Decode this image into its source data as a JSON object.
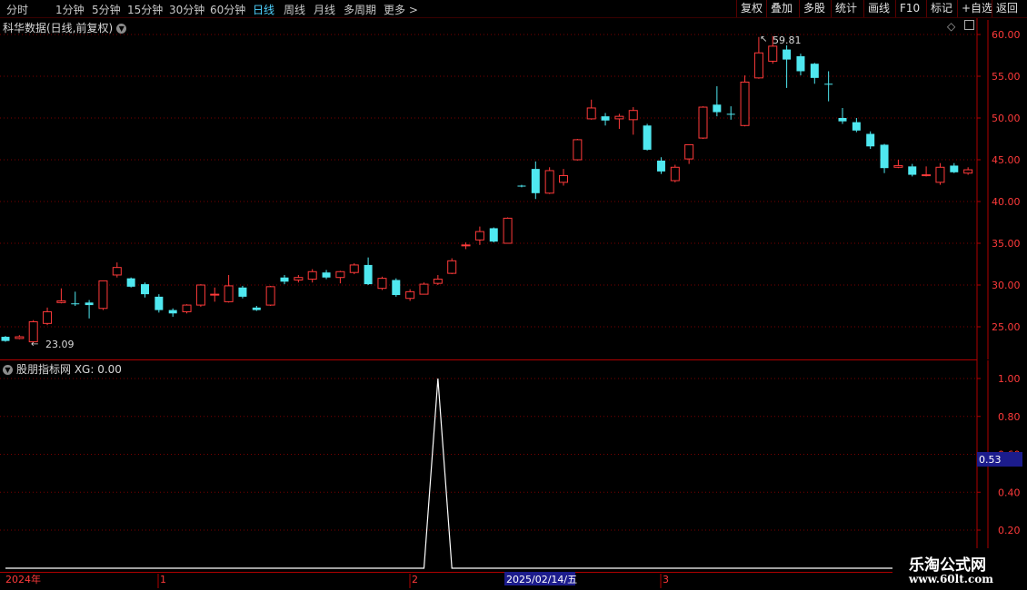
{
  "toolbar": {
    "periods": [
      "分时",
      "1分钟",
      "5分钟",
      "15分钟",
      "30分钟",
      "60分钟",
      "日线",
      "周线",
      "月线",
      "多周期",
      "更多"
    ],
    "active_period": "日线",
    "right_buttons": [
      "复权",
      "叠加",
      "多股",
      "统计",
      "画线",
      "F10",
      "标记",
      "+自选",
      "返回"
    ]
  },
  "main_chart": {
    "title": "科华数据(日线,前复权)",
    "high_label": "59.81",
    "low_label": "23.09"
  },
  "indicator": {
    "title": "股朋指标网 XG: 0.00",
    "cursor_value": "0.53"
  },
  "timeline": {
    "labels": [
      "2024年",
      "1",
      "2",
      "2025/02/14/五",
      "3"
    ]
  },
  "watermark": {
    "title": "乐淘公式网",
    "url": "www.60lt.com"
  },
  "colors": {
    "up": "#ff3a3a",
    "down": "#4fe8f0",
    "grid": "#7a0000",
    "axis": "#b00000",
    "accent": "#4fd2ff"
  },
  "chart_data": [
    {
      "type": "candlestick",
      "title": "科华数据(日线,前复权)",
      "ylim": [
        21,
        61
      ],
      "yticks": [
        25,
        30,
        35,
        40,
        45,
        50,
        55,
        60
      ],
      "ytick_labels": [
        "25.00",
        "30.00",
        "35.00",
        "40.00",
        "45.00",
        "50.00",
        "55.00",
        "60.00"
      ],
      "candles": [
        [
          23.8,
          23.3,
          23.9,
          23.2
        ],
        [
          23.6,
          23.8,
          24.0,
          23.5
        ],
        [
          23.2,
          25.6,
          25.8,
          23.09
        ],
        [
          25.4,
          26.8,
          27.3,
          25.2
        ],
        [
          27.9,
          28.1,
          29.6,
          27.8
        ],
        [
          27.8,
          27.7,
          29.2,
          27.5
        ],
        [
          27.9,
          27.6,
          28.2,
          26.0
        ],
        [
          27.2,
          30.5,
          30.5,
          27.0
        ],
        [
          31.2,
          32.1,
          32.7,
          30.9
        ],
        [
          30.8,
          29.8,
          30.9,
          29.7
        ],
        [
          30.1,
          28.9,
          30.3,
          28.5
        ],
        [
          28.6,
          27.0,
          28.9,
          26.7
        ],
        [
          27.0,
          26.6,
          27.2,
          26.2
        ],
        [
          26.8,
          27.6,
          27.7,
          26.6
        ],
        [
          27.6,
          30.0,
          30.1,
          27.4
        ],
        [
          28.8,
          28.9,
          29.7,
          28.0
        ],
        [
          28.0,
          29.9,
          31.2,
          27.9
        ],
        [
          29.7,
          28.6,
          29.9,
          28.4
        ],
        [
          27.3,
          27.0,
          27.5,
          26.9
        ],
        [
          27.6,
          29.8,
          29.9,
          27.5
        ],
        [
          30.9,
          30.4,
          31.2,
          30.1
        ],
        [
          30.6,
          30.9,
          31.2,
          30.3
        ],
        [
          30.7,
          31.6,
          31.9,
          30.3
        ],
        [
          31.5,
          30.9,
          31.8,
          30.7
        ],
        [
          30.9,
          31.6,
          31.7,
          30.2
        ],
        [
          31.5,
          32.4,
          32.6,
          31.3
        ],
        [
          32.4,
          30.1,
          33.3,
          30.0
        ],
        [
          29.6,
          30.8,
          31.0,
          29.4
        ],
        [
          30.6,
          28.8,
          30.8,
          28.6
        ],
        [
          28.4,
          29.2,
          29.5,
          28.1
        ],
        [
          28.9,
          30.1,
          30.3,
          28.9
        ],
        [
          30.2,
          30.7,
          31.2,
          30.0
        ],
        [
          31.4,
          32.9,
          33.2,
          31.3
        ],
        [
          34.7,
          34.8,
          35.1,
          34.3
        ],
        [
          35.4,
          36.4,
          37.0,
          34.8
        ],
        [
          36.8,
          35.2,
          36.9,
          35.1
        ],
        [
          35.0,
          38.0,
          38.1,
          35.0
        ],
        [
          41.9,
          41.8,
          42.0,
          41.7
        ],
        [
          43.9,
          41.0,
          44.8,
          40.3
        ],
        [
          41.0,
          43.7,
          44.1,
          40.9
        ],
        [
          42.3,
          43.1,
          43.9,
          41.9
        ],
        [
          45.0,
          47.4,
          47.5,
          44.9
        ],
        [
          49.9,
          51.2,
          52.2,
          49.8
        ],
        [
          50.2,
          49.7,
          50.6,
          49.1
        ],
        [
          49.9,
          50.2,
          50.5,
          48.7
        ],
        [
          49.8,
          50.9,
          51.3,
          48.0
        ],
        [
          49.1,
          46.2,
          49.3,
          46.1
        ],
        [
          44.9,
          43.6,
          45.3,
          43.3
        ],
        [
          42.5,
          44.1,
          44.4,
          42.3
        ],
        [
          45.1,
          46.8,
          46.8,
          44.5
        ],
        [
          47.6,
          51.3,
          51.4,
          47.5
        ],
        [
          51.6,
          50.7,
          53.8,
          50.2
        ],
        [
          50.5,
          50.4,
          51.4,
          49.8
        ],
        [
          49.1,
          54.3,
          55.1,
          49.0
        ],
        [
          54.8,
          57.8,
          59.7,
          54.7
        ],
        [
          56.8,
          58.6,
          59.81,
          56.5
        ],
        [
          58.2,
          57.0,
          58.7,
          53.6
        ],
        [
          57.4,
          55.6,
          57.7,
          55.1
        ],
        [
          56.5,
          54.8,
          56.6,
          54.1
        ],
        [
          54.1,
          54.0,
          55.6,
          52.0
        ],
        [
          50.0,
          49.6,
          51.2,
          49.3
        ],
        [
          49.5,
          48.5,
          50.0,
          48.3
        ],
        [
          48.1,
          46.6,
          48.4,
          46.3
        ],
        [
          46.8,
          44.0,
          46.9,
          43.4
        ],
        [
          44.1,
          44.3,
          45.0,
          44.0
        ],
        [
          44.2,
          43.2,
          44.5,
          43.0
        ],
        [
          43.1,
          43.2,
          44.2,
          43.0
        ],
        [
          42.3,
          44.1,
          44.6,
          42.0
        ],
        [
          44.3,
          43.5,
          44.6,
          43.4
        ],
        [
          43.4,
          43.8,
          44.1,
          43.2
        ]
      ]
    },
    {
      "type": "line",
      "title": "股朋指标网 XG",
      "ylim": [
        0.1,
        1.05
      ],
      "yticks": [
        0.2,
        0.4,
        0.6,
        0.8,
        1.0
      ],
      "ytick_labels": [
        "0.20",
        "0.40",
        "0.60",
        "0.80",
        "1.00"
      ],
      "series": [
        {
          "name": "XG",
          "peak_index": 31,
          "peak_value": 1.0,
          "base_value": 0.0
        }
      ]
    }
  ]
}
